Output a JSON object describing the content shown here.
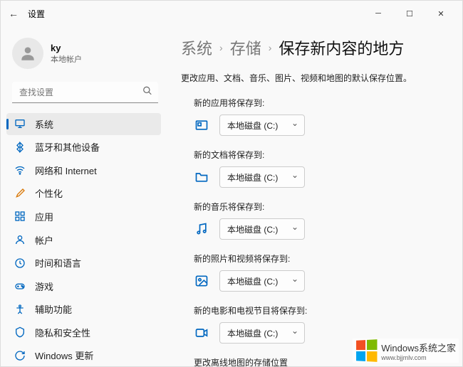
{
  "titlebar": {
    "title": "设置"
  },
  "user": {
    "name": "ky",
    "type": "本地帐户"
  },
  "search": {
    "placeholder": "查找设置"
  },
  "sidebar": {
    "items": [
      {
        "label": "系统"
      },
      {
        "label": "蓝牙和其他设备"
      },
      {
        "label": "网络和 Internet"
      },
      {
        "label": "个性化"
      },
      {
        "label": "应用"
      },
      {
        "label": "帐户"
      },
      {
        "label": "时间和语言"
      },
      {
        "label": "游戏"
      },
      {
        "label": "辅助功能"
      },
      {
        "label": "隐私和安全性"
      },
      {
        "label": "Windows 更新"
      }
    ]
  },
  "breadcrumb": {
    "system": "系统",
    "storage": "存储",
    "current": "保存新内容的地方"
  },
  "description": "更改应用、文档、音乐、图片、视频和地图的默认保存位置。",
  "storage": {
    "sections": [
      {
        "label": "新的应用将保存到:",
        "value": "本地磁盘 (C:)"
      },
      {
        "label": "新的文档将保存到:",
        "value": "本地磁盘 (C:)"
      },
      {
        "label": "新的音乐将保存到:",
        "value": "本地磁盘 (C:)"
      },
      {
        "label": "新的照片和视频将保存到:",
        "value": "本地磁盘 (C:)"
      },
      {
        "label": "新的电影和电视节目将保存到:",
        "value": "本地磁盘 (C:)"
      }
    ],
    "offline_maps_label": "更改离线地图的存储位置"
  },
  "watermark": {
    "text": "Windows系统之家",
    "url": "www.bjjmlv.com"
  }
}
